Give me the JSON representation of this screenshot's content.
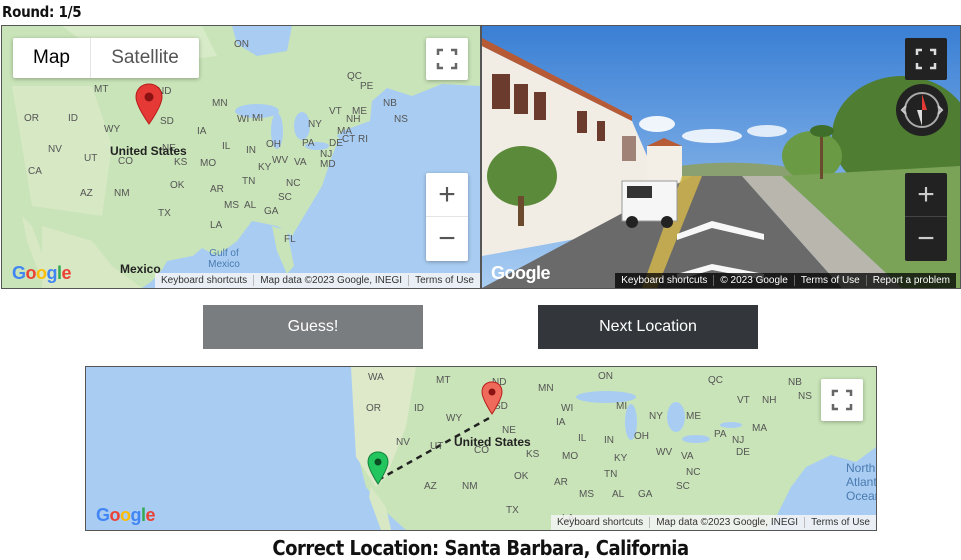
{
  "header": {
    "round": "Round: 1/5"
  },
  "guess_map": {
    "tabs": [
      "Map",
      "Satellite"
    ],
    "labels": {
      "country": "United States",
      "mexico": "Mexico",
      "gulf": "Gulf of Mexico",
      "states": [
        "ON",
        "QC",
        "NB",
        "NS",
        "PE",
        "MT",
        "ND",
        "MN",
        "OR",
        "ID",
        "WY",
        "SD",
        "WI",
        "MI",
        "NY",
        "ME",
        "VT",
        "NH",
        "MA",
        "CT",
        "RI",
        "IA",
        "PA",
        "NJ",
        "NV",
        "NE",
        "IL",
        "IN",
        "OH",
        "DE",
        "MD",
        "UT",
        "CO",
        "KS",
        "MO",
        "KY",
        "WV",
        "VA",
        "CA",
        "TN",
        "NC",
        "AZ",
        "NM",
        "OK",
        "AR",
        "SC",
        "MS",
        "AL",
        "GA",
        "TX",
        "LA",
        "FL"
      ]
    },
    "attribution": [
      "Keyboard shortcuts",
      "Map data ©2023 Google, INEGI",
      "Terms of Use"
    ],
    "zoom_in": "+",
    "zoom_out": "−"
  },
  "streetview": {
    "attribution": [
      "Keyboard shortcuts",
      "© 2023 Google",
      "Terms of Use",
      "Report a problem"
    ],
    "zoom_in": "+",
    "zoom_out": "−"
  },
  "buttons": {
    "guess": "Guess!",
    "next": "Next Location"
  },
  "result_map": {
    "country": "United States",
    "states": [
      "WA",
      "MT",
      "ND",
      "MN",
      "ON",
      "QC",
      "NB",
      "NS",
      "OR",
      "ID",
      "SD",
      "WI",
      "MI",
      "NY",
      "ME",
      "VT",
      "NH",
      "WY",
      "IA",
      "PA",
      "MA",
      "NV",
      "NE",
      "IL",
      "IN",
      "OH",
      "NJ",
      "UT",
      "CO",
      "KS",
      "MO",
      "KY",
      "WV",
      "VA",
      "DE",
      "CA",
      "TN",
      "NC",
      "AZ",
      "NM",
      "OK",
      "AR",
      "SC",
      "MS",
      "AL",
      "GA",
      "TX",
      "LA"
    ],
    "water": "North Atlantic Ocean",
    "attribution": [
      "Keyboard shortcuts",
      "Map data ©2023 Google, INEGI",
      "Terms of Use"
    ]
  },
  "result": {
    "text": "Correct Location: Santa Barbara, California"
  },
  "colors": {
    "water": "#a9cdf2",
    "land": "#c9e4b8",
    "guess_btn": "#7a7d80",
    "next_btn": "#33373b",
    "pin_red": "#e53935",
    "pin_green": "#22c55e"
  }
}
